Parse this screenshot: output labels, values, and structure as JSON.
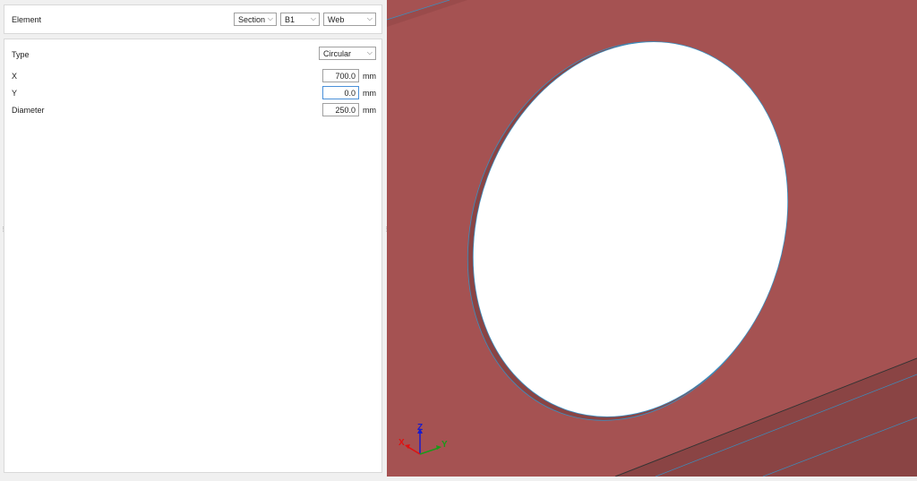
{
  "element": {
    "label": "Element",
    "section": "Section",
    "member": "B1",
    "part": "Web"
  },
  "props": {
    "type_label": "Type",
    "type_value": "Circular",
    "fields": [
      {
        "label": "X",
        "value": "700.0",
        "unit": "mm"
      },
      {
        "label": "Y",
        "value": "0.0",
        "unit": "mm"
      },
      {
        "label": "Diameter",
        "value": "250.0",
        "unit": "mm"
      }
    ]
  },
  "axes": {
    "x": "X",
    "y": "Y",
    "z": "Z"
  },
  "colors": {
    "plate": "#a55252",
    "plate_dark": "#8a4444",
    "edge": "#3a8fc0"
  }
}
